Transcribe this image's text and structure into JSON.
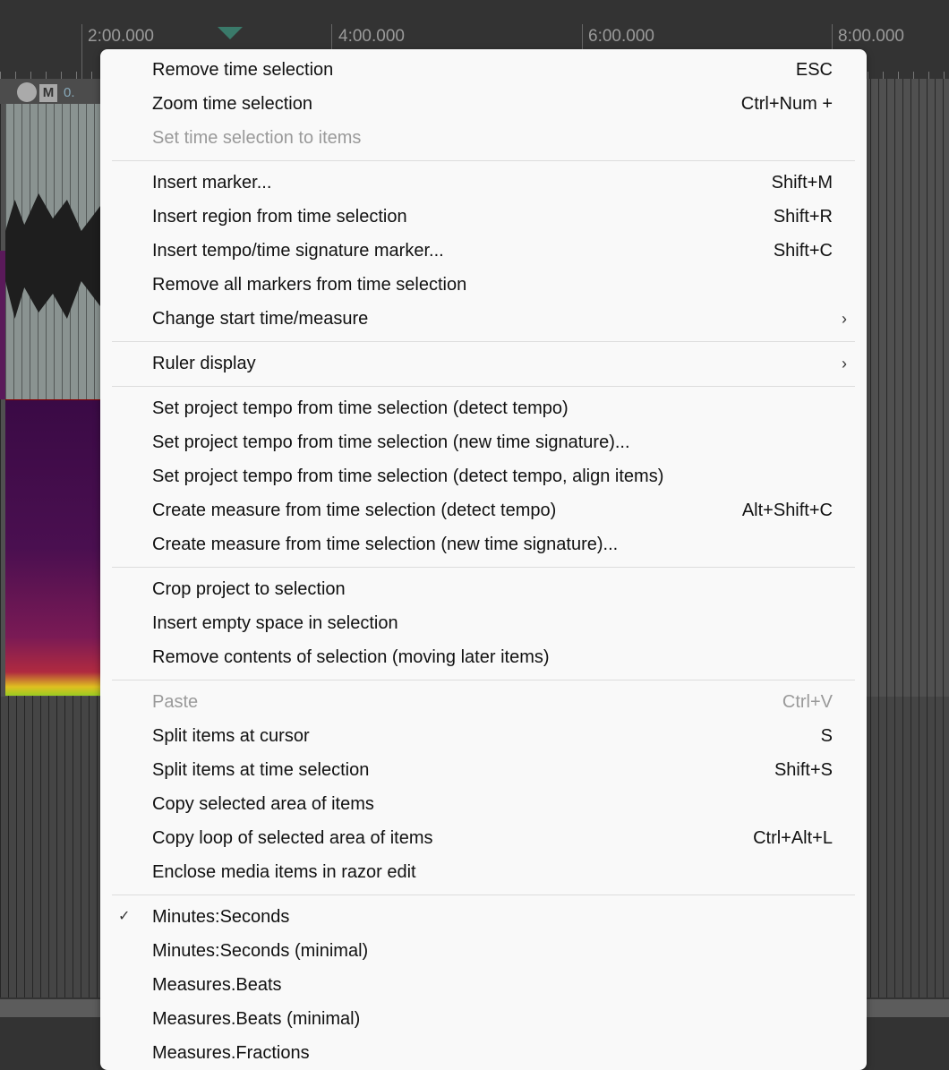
{
  "ruler": {
    "labels": [
      "2:00.000",
      "4:00.000",
      "6:00.000",
      "8:00.000"
    ]
  },
  "track": {
    "mute_label": "M",
    "value": "0."
  },
  "menu": {
    "groups": [
      [
        {
          "label": "Remove time selection",
          "shortcut": "ESC"
        },
        {
          "label": "Zoom time selection",
          "shortcut": "Ctrl+Num +"
        },
        {
          "label": "Set time selection to items",
          "shortcut": "",
          "disabled": true
        }
      ],
      [
        {
          "label": "Insert marker...",
          "shortcut": "Shift+M"
        },
        {
          "label": "Insert region from time selection",
          "shortcut": "Shift+R"
        },
        {
          "label": "Insert tempo/time signature marker...",
          "shortcut": "Shift+C"
        },
        {
          "label": "Remove all markers from time selection",
          "shortcut": ""
        },
        {
          "label": "Change start time/measure",
          "shortcut": "",
          "submenu": true
        }
      ],
      [
        {
          "label": "Ruler display",
          "shortcut": "",
          "submenu": true
        }
      ],
      [
        {
          "label": "Set project tempo from time selection (detect tempo)",
          "shortcut": ""
        },
        {
          "label": "Set project tempo from time selection (new time signature)...",
          "shortcut": ""
        },
        {
          "label": "Set project tempo from time selection (detect tempo, align items)",
          "shortcut": ""
        },
        {
          "label": "Create measure from time selection (detect tempo)",
          "shortcut": "Alt+Shift+C"
        },
        {
          "label": "Create measure from time selection (new time signature)...",
          "shortcut": ""
        }
      ],
      [
        {
          "label": "Crop project to selection",
          "shortcut": ""
        },
        {
          "label": "Insert empty space in selection",
          "shortcut": ""
        },
        {
          "label": "Remove contents of selection (moving later items)",
          "shortcut": ""
        }
      ],
      [
        {
          "label": "Paste",
          "shortcut": "Ctrl+V",
          "disabled": true
        },
        {
          "label": "Split items at cursor",
          "shortcut": "S"
        },
        {
          "label": "Split items at time selection",
          "shortcut": "Shift+S"
        },
        {
          "label": "Copy selected area of items",
          "shortcut": ""
        },
        {
          "label": "Copy loop of selected area of items",
          "shortcut": "Ctrl+Alt+L"
        },
        {
          "label": "Enclose media items in razor edit",
          "shortcut": ""
        }
      ],
      [
        {
          "label": "Minutes:Seconds",
          "shortcut": "",
          "checked": true
        },
        {
          "label": "Minutes:Seconds (minimal)",
          "shortcut": ""
        },
        {
          "label": "Measures.Beats",
          "shortcut": ""
        },
        {
          "label": "Measures.Beats (minimal)",
          "shortcut": ""
        },
        {
          "label": "Measures.Fractions",
          "shortcut": ""
        }
      ]
    ]
  }
}
